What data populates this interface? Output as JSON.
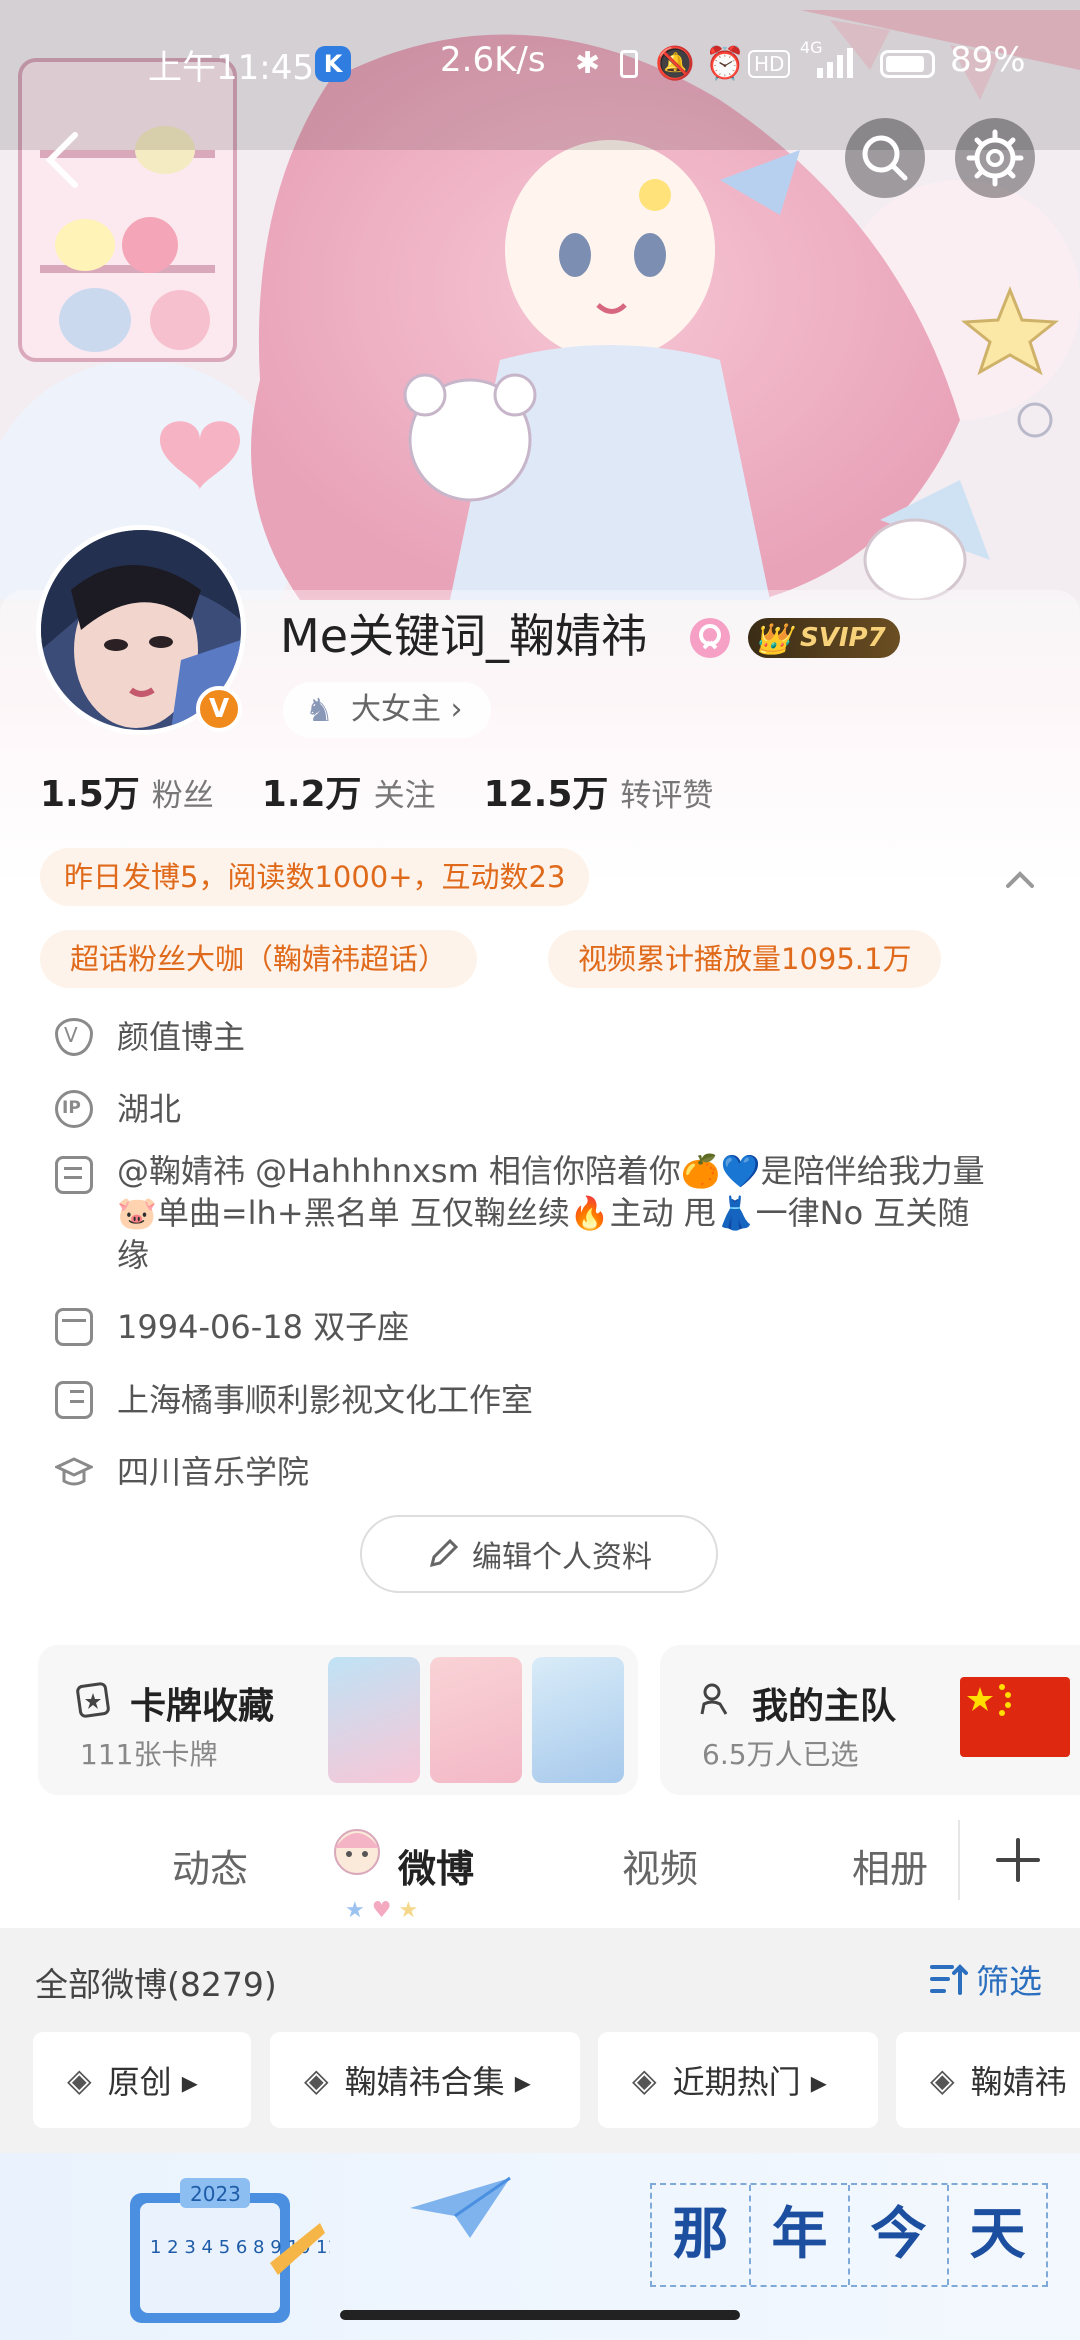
{
  "status": {
    "time": "上午11:45",
    "k_badge": "K",
    "speed": "2.6K/s",
    "net": "4G",
    "battery": "89%"
  },
  "profile": {
    "name": "Me关键词_鞠婧祎",
    "vip": "SVIP7",
    "role_tag": "大女主 ›",
    "stats": [
      {
        "num": "1.5万",
        "label": "粉丝"
      },
      {
        "num": "1.2万",
        "label": "关注"
      },
      {
        "num": "12.5万",
        "label": "转评赞"
      }
    ],
    "activity_note": "昨日发博5，阅读数1000+，互动数23",
    "tags": [
      "超话粉丝大咖（鞠婧祎超话）",
      "视频累计播放量1095.1万"
    ],
    "info": [
      {
        "icon": "verified-icon",
        "text": "颜值博主"
      },
      {
        "icon": "ip-location-icon",
        "text": "湖北"
      },
      {
        "icon": "bio-icon",
        "text": "@鞠婧祎 @Hahhhnxsm 相信你陪着你🍊💙是陪伴给我力量🐷单曲=lh+黑名单 互仅鞠丝续🔥主动 甩👗一律No 互关随缘"
      },
      {
        "icon": "calendar-icon",
        "text": "1994-06-18 双子座"
      },
      {
        "icon": "company-icon",
        "text": "上海橘事顺利影视文化工作室"
      },
      {
        "icon": "school-icon",
        "text": "四川音乐学院"
      }
    ],
    "edit_button": "编辑个人资料"
  },
  "cards": [
    {
      "title": "卡牌收藏",
      "sub": "111张卡牌"
    },
    {
      "title": "我的主队",
      "sub": "6.5万人已选"
    }
  ],
  "tabs": [
    "动态",
    "微博",
    "视频",
    "相册"
  ],
  "active_tab": "微博",
  "feed": {
    "count_label": "全部微博(8279)",
    "filter_label": "筛选",
    "chips": [
      "原创 ▸",
      "鞠婧祎合集 ▸",
      "近期热门 ▸",
      "鞠婧祎"
    ]
  },
  "banner": {
    "chars": [
      "那",
      "年",
      "今",
      "天"
    ],
    "calendar_year": "2023",
    "calendar_digits": "1 2 3 4 5 6 8 9 10 11 12"
  },
  "colors": {
    "orange": "#e06a1b",
    "accent_blue": "#2c6fbf",
    "chip_bg": "#fdf3ea"
  }
}
